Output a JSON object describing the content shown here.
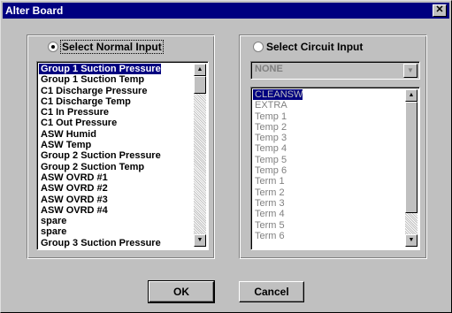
{
  "window": {
    "title": "Alter Board",
    "close_glyph": "✕"
  },
  "left_group": {
    "radio_label": "Select Normal Input",
    "radio_selected": true,
    "list": {
      "items": [
        "Group 1 Suction Pressure",
        "Group 1 Suction Temp",
        "C1 Discharge Pressure",
        "C1 Discharge Temp",
        "C1 In Pressure",
        "C1 Out Pressure",
        "ASW Humid",
        "ASW Temp",
        "Group 2 Suction Pressure",
        "Group 2 Suction Temp",
        "ASW OVRD #1",
        "ASW OVRD #2",
        "ASW OVRD #3",
        "ASW OVRD #4",
        "spare",
        "spare",
        "Group 3 Suction Pressure"
      ],
      "selected_index": 0
    }
  },
  "right_group": {
    "radio_label": "Select Circuit Input",
    "radio_selected": false,
    "combo": {
      "value": "NONE"
    },
    "list": {
      "items": [
        "CLEANSW",
        "EXTRA",
        "Temp 1",
        "Temp 2",
        "Temp 3",
        "Temp 4",
        "Temp 5",
        "Temp 6",
        "Term 1",
        "Term 2",
        "Term 3",
        "Term 4",
        "Term 5",
        "Term 6"
      ],
      "selected_index": 0
    }
  },
  "buttons": {
    "ok": "OK",
    "cancel": "Cancel"
  },
  "icons": {
    "scroll_up": "scroll-up-arrow-icon",
    "scroll_down": "scroll-down-arrow-icon",
    "dropdown": "dropdown-arrow-icon"
  }
}
